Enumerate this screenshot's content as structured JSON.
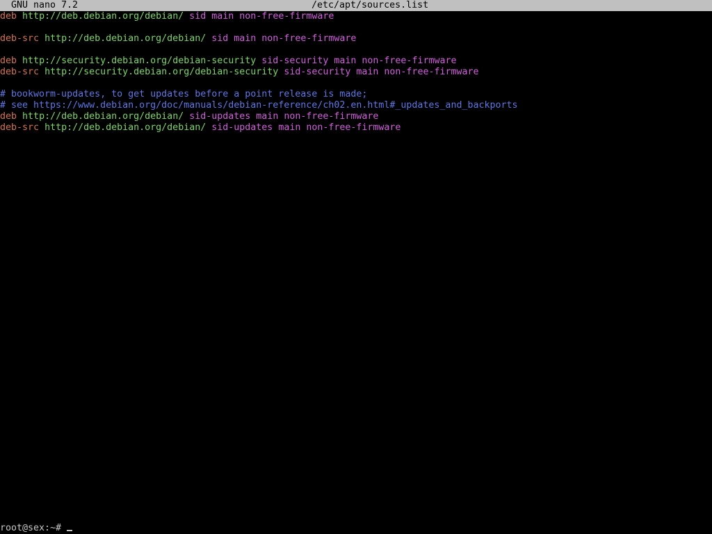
{
  "titlebar": {
    "app_name": "GNU nano 7.2",
    "file_path": "/etc/apt/sources.list"
  },
  "editor": {
    "lines": [
      {
        "keyword": "deb",
        "url": "http://deb.debian.org/debian/",
        "components": "sid main non-free-firmware",
        "comment": ""
      },
      {
        "keyword": "",
        "url": "",
        "components": "",
        "comment": ""
      },
      {
        "keyword": "deb-src",
        "url": "http://deb.debian.org/debian/",
        "components": "sid main non-free-firmware",
        "comment": ""
      },
      {
        "keyword": "",
        "url": "",
        "components": "",
        "comment": ""
      },
      {
        "keyword": "deb",
        "url": "http://security.debian.org/debian-security",
        "components": "sid-security main non-free-firmware",
        "comment": ""
      },
      {
        "keyword": "deb-src",
        "url": "http://security.debian.org/debian-security",
        "components": "sid-security main non-free-firmware",
        "comment": ""
      },
      {
        "keyword": "",
        "url": "",
        "components": "",
        "comment": ""
      },
      {
        "keyword": "",
        "url": "",
        "components": "",
        "comment": "# bookworm-updates, to get updates before a point release is made;"
      },
      {
        "keyword": "",
        "url": "",
        "components": "",
        "comment": "# see https://www.debian.org/doc/manuals/debian-reference/ch02.en.html#_updates_and_backports"
      },
      {
        "keyword": "deb",
        "url": "http://deb.debian.org/debian/",
        "components": "sid-updates main non-free-firmware",
        "comment": ""
      },
      {
        "keyword": "deb-src",
        "url": "http://deb.debian.org/debian/",
        "components": "sid-updates main non-free-firmware",
        "comment": ""
      }
    ]
  },
  "shell": {
    "prompt": "root@sex:~# "
  },
  "colors": {
    "keyword": "#d8754f",
    "url": "#7cd865",
    "components": "#d45ee0",
    "comment": "#5b78e6",
    "title_bar": "#c0c0c0"
  }
}
